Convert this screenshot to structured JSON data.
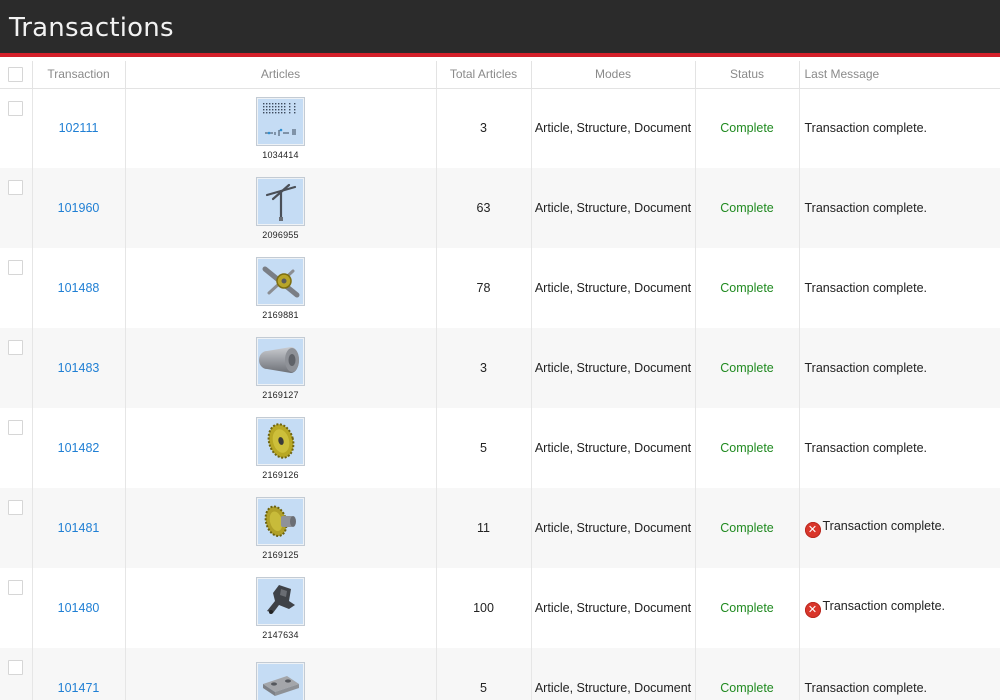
{
  "page": {
    "title": "Transactions"
  },
  "columns": {
    "transaction": "Transaction",
    "articles": "Articles",
    "total_articles": "Total Articles",
    "modes": "Modes",
    "status": "Status",
    "last_message": "Last Message"
  },
  "rows": [
    {
      "id": "102111",
      "article_id": "1034414",
      "article_icon": "schematic-drawing-icon",
      "total": "3",
      "modes": "Article, Structure, Document",
      "status": "Complete",
      "message": "Transaction complete.",
      "error": false
    },
    {
      "id": "101960",
      "article_id": "2096955",
      "article_icon": "antenna-part-icon",
      "total": "63",
      "modes": "Article, Structure, Document",
      "status": "Complete",
      "message": "Transaction complete.",
      "error": false
    },
    {
      "id": "101488",
      "article_id": "2169881",
      "article_icon": "gear-assembly-icon",
      "total": "78",
      "modes": "Article, Structure, Document",
      "status": "Complete",
      "message": "Transaction complete.",
      "error": false
    },
    {
      "id": "101483",
      "article_id": "2169127",
      "article_icon": "cylinder-part-icon",
      "total": "3",
      "modes": "Article, Structure, Document",
      "status": "Complete",
      "message": "Transaction complete.",
      "error": false
    },
    {
      "id": "101482",
      "article_id": "2169126",
      "article_icon": "sprocket-part-icon",
      "total": "5",
      "modes": "Article, Structure, Document",
      "status": "Complete",
      "message": "Transaction complete.",
      "error": false
    },
    {
      "id": "101481",
      "article_id": "2169125",
      "article_icon": "sprocket-hub-part-icon",
      "total": "11",
      "modes": "Article, Structure, Document",
      "status": "Complete",
      "message": "Transaction complete.",
      "error": true
    },
    {
      "id": "101480",
      "article_id": "2147634",
      "article_icon": "bracket-part-icon",
      "total": "100",
      "modes": "Article, Structure, Document",
      "status": "Complete",
      "message": "Transaction complete.",
      "error": true
    },
    {
      "id": "101471",
      "article_id": "",
      "article_icon": "plate-part-icon",
      "total": "5",
      "modes": "Article, Structure, Document",
      "status": "Complete",
      "message": "Transaction complete.",
      "error": false
    }
  ],
  "colors": {
    "accent": "#d4202a",
    "link": "#1f7fd4",
    "status_complete": "#1f8a1f",
    "error": "#d9362b",
    "titlebar": "#2b2b2b"
  }
}
